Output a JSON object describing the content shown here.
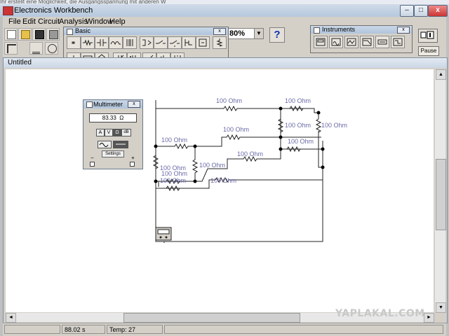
{
  "background_strip": "Ihr erstellt eine Möglichkeit, die Ausgangsspannung mit anderen W",
  "window": {
    "title": "Electronics Workbench",
    "minimize": "–",
    "maximize": "□",
    "close": "x"
  },
  "menu": [
    "File",
    "Edit",
    "Circuit",
    "Analysis",
    "Window",
    "Help"
  ],
  "toolbar": {
    "zoom": "80%",
    "help": "?",
    "pause": "Pause"
  },
  "basic_palette": {
    "title": "Basic",
    "close": "x"
  },
  "instruments_palette": {
    "title": "Instruments",
    "close": "x"
  },
  "document": {
    "title": "Untitled"
  },
  "multimeter": {
    "title": "Multimeter",
    "close": "x",
    "reading": "83.33",
    "unit": "Ω",
    "buttons": [
      "A",
      "V",
      "Ω",
      "dB"
    ],
    "settings": "Settings",
    "minus": "−",
    "plus": "+"
  },
  "resistors": [
    "100 Ohm",
    "100 Ohm",
    "100 Ohm",
    "100 Ohm",
    "100 Ohm",
    "100 Ohm",
    "100 Ohm",
    "100 Ohm",
    "100 Ohm",
    "100 Ohm",
    "100 Ohm",
    "100 Ohm",
    "100 Ohm"
  ],
  "status": {
    "time": "88.02 s",
    "temp": "Temp:  27"
  },
  "watermark": "YAPLAKAL.COM",
  "colors": {
    "canvas": "#ffffff",
    "chrome": "#d4d0c8",
    "wire": "#222222",
    "resistor_label": "#6a6aa8"
  }
}
